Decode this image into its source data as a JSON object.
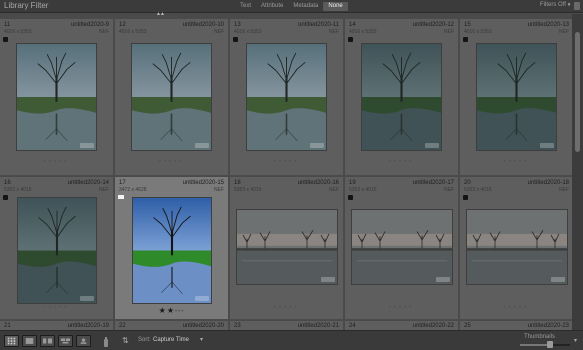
{
  "filter_bar": {
    "title": "Library Filter",
    "tabs": [
      "Text",
      "Attribute",
      "Metadata",
      "None"
    ],
    "active_tab": "None",
    "filters_label": "Filters Off ♦"
  },
  "grid": {
    "cells": [
      {
        "index": "11",
        "filename": "untitled2020-9",
        "dims": "4016 x 5353",
        "ext": "NEF",
        "photo": "tree-portrait",
        "tone": "dim",
        "badge": "mark",
        "footer": "dots"
      },
      {
        "index": "12",
        "filename": "untitled2020-10",
        "dims": "4016 x 5353",
        "ext": "NEF",
        "photo": "tree-portrait",
        "tone": "dim",
        "badge": "",
        "footer": "dots"
      },
      {
        "index": "13",
        "filename": "untitled2020-11",
        "dims": "4016 x 5353",
        "ext": "NEF",
        "photo": "tree-portrait",
        "tone": "dim",
        "badge": "mark",
        "footer": "dots"
      },
      {
        "index": "14",
        "filename": "untitled2020-12",
        "dims": "4016 x 5353",
        "ext": "NEF",
        "photo": "tree-portrait",
        "tone": "dark",
        "badge": "mark",
        "footer": "dots"
      },
      {
        "index": "15",
        "filename": "untitled2020-13",
        "dims": "4016 x 5353",
        "ext": "NEF",
        "photo": "tree-portrait",
        "tone": "dark",
        "badge": "mark",
        "footer": "dots"
      },
      {
        "index": "16",
        "filename": "untitled2020-14",
        "dims": "5353 x 4016",
        "ext": "NEF",
        "photo": "tree-portrait",
        "tone": "dark",
        "badge": "mark",
        "footer": "dots"
      },
      {
        "index": "17",
        "filename": "untitled2020-15",
        "dims": "3472 x 4628",
        "ext": "NEF",
        "photo": "tree-portrait",
        "tone": "vivid",
        "badge": "flag",
        "footer": "stars",
        "selected": true
      },
      {
        "index": "18",
        "filename": "untitled2020-16",
        "dims": "5353 x 4016",
        "ext": "NEF",
        "photo": "lake-landscape",
        "tone": "dim",
        "badge": "",
        "footer": "dots"
      },
      {
        "index": "19",
        "filename": "untitled2020-17",
        "dims": "5353 x 4016",
        "ext": "NEF",
        "photo": "lake-landscape",
        "tone": "dim",
        "badge": "mark",
        "footer": "dots"
      },
      {
        "index": "20",
        "filename": "untitled2020-18",
        "dims": "5353 x 4016",
        "ext": "NEF",
        "photo": "lake-landscape",
        "tone": "dim",
        "badge": "mark",
        "footer": "dots"
      },
      {
        "index": "21",
        "filename": "untitled2020-19",
        "dims": "5353 x 4016",
        "ext": "NEF",
        "photo": "",
        "tone": "dim",
        "badge": "",
        "footer": ""
      },
      {
        "index": "22",
        "filename": "untitled2020-20",
        "dims": "5353 x 4016",
        "ext": "NEF",
        "photo": "",
        "tone": "dim",
        "badge": "",
        "footer": ""
      },
      {
        "index": "23",
        "filename": "untitled2020-21",
        "dims": "5353 x 4016",
        "ext": "NEF",
        "photo": "",
        "tone": "dim",
        "badge": "",
        "footer": ""
      },
      {
        "index": "24",
        "filename": "untitled2020-22",
        "dims": "5417 x 3783",
        "ext": "NEF",
        "photo": "",
        "tone": "dim",
        "badge": "flag",
        "footer": ""
      },
      {
        "index": "25",
        "filename": "untitled2020-23",
        "dims": "5353 x 4016",
        "ext": "NEF",
        "photo": "",
        "tone": "dim",
        "badge": "",
        "footer": ""
      }
    ],
    "rating_selected": 2,
    "rating_max": 5
  },
  "toolbar": {
    "sort_label": "Sort:",
    "sort_value": "Capture Time",
    "thumbnails_label": "Thumbnails",
    "thumbnail_size": 0.6
  },
  "icons": {
    "grid_view": "grid-view-icon",
    "loupe_view": "loupe-view-icon",
    "compare_view": "compare-view-icon",
    "survey_view": "survey-view-icon",
    "painter": "spray-can-icon",
    "sort_direction": "sort-direction-icon"
  },
  "colors": {
    "cell_bg": "#5e5e5e",
    "cell_selected": "#7a7a7a",
    "panel_bg": "#3a3a3a"
  }
}
